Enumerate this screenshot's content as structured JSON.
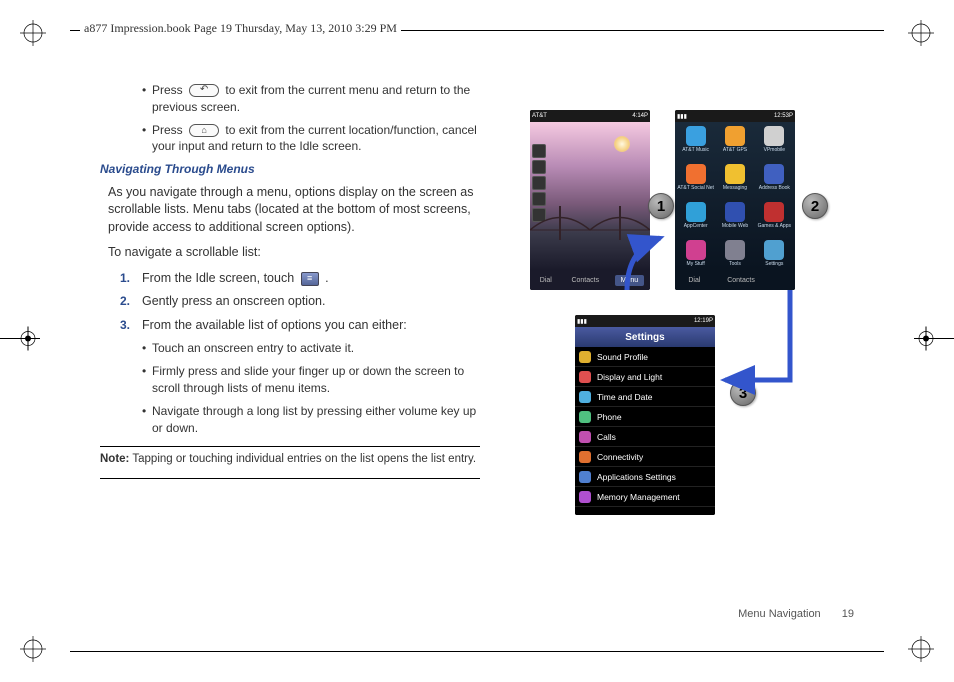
{
  "header": {
    "crop_line": "a877 Impression.book  Page 19  Thursday, May 13, 2010  3:29 PM"
  },
  "body": {
    "bullets_top": [
      {
        "pre": "Press",
        "icon": "return",
        "post": " to exit from the current menu and return to the previous screen."
      },
      {
        "pre": "Press",
        "icon": "home",
        "post": " to exit from the current location/function, cancel your input and return to the Idle screen."
      }
    ],
    "section_title": "Navigating Through Menus",
    "para1": "As you navigate through a menu, options display on the screen as scrollable lists. Menu tabs (located at the bottom of most screens, provide access to additional screen options).",
    "para2": "To navigate a scrollable list:",
    "steps": [
      {
        "n": "1.",
        "pre": "From the Idle screen, touch ",
        "icon": "menu",
        "post": " ."
      },
      {
        "n": "2.",
        "text": "Gently press an onscreen option."
      },
      {
        "n": "3.",
        "text": "From the available list of options you can either:"
      }
    ],
    "sub_bullets": [
      "Touch an onscreen entry to activate it.",
      "Firmly press and slide your finger up or down the screen to scroll through lists of menu items.",
      "Navigate through a long list by pressing either volume key up or down."
    ],
    "note_label": "Note:",
    "note_text": " Tapping or touching individual entries on the list opens the list entry."
  },
  "figure": {
    "badges": {
      "b1": "1",
      "b2": "2",
      "b3": "3"
    },
    "phone1": {
      "carrier": "AT&T",
      "time": "4:14P",
      "softkeys": {
        "left": "Dial",
        "mid": "Menu",
        "right": "Contacts"
      }
    },
    "phone2": {
      "time": "12:53P",
      "apps": [
        {
          "label": "AT&T Music",
          "color": "#3aa0e0"
        },
        {
          "label": "AT&T GPS",
          "color": "#f0a030"
        },
        {
          "label": "VPmobile",
          "color": "#d0d0d0"
        },
        {
          "label": "AT&T Social Net",
          "color": "#f07030"
        },
        {
          "label": "Messaging",
          "color": "#f0c030"
        },
        {
          "label": "Address Book",
          "color": "#4060c0"
        },
        {
          "label": "AppCenter",
          "color": "#30a0d8"
        },
        {
          "label": "Mobile Web",
          "color": "#3050b0"
        },
        {
          "label": "Games & Apps",
          "color": "#c03030"
        },
        {
          "label": "My Stuff",
          "color": "#d04090"
        },
        {
          "label": "Tools",
          "color": "#808090"
        },
        {
          "label": "Settings",
          "color": "#50a0d0"
        }
      ],
      "softkeys": {
        "left": "Dial",
        "mid": "Contacts",
        "right": ""
      }
    },
    "phone3": {
      "time": "12:19P",
      "title": "Settings",
      "rows": [
        {
          "label": "Sound Profile",
          "color": "#e0b030"
        },
        {
          "label": "Display and Light",
          "color": "#e05050"
        },
        {
          "label": "Time and Date",
          "color": "#50b0e0"
        },
        {
          "label": "Phone",
          "color": "#50c080"
        },
        {
          "label": "Calls",
          "color": "#c050b0"
        },
        {
          "label": "Connectivity",
          "color": "#e07030"
        },
        {
          "label": "Applications Settings",
          "color": "#5080d0"
        },
        {
          "label": "Memory Management",
          "color": "#b050d0"
        }
      ]
    }
  },
  "footer": {
    "section": "Menu Navigation",
    "page": "19"
  }
}
